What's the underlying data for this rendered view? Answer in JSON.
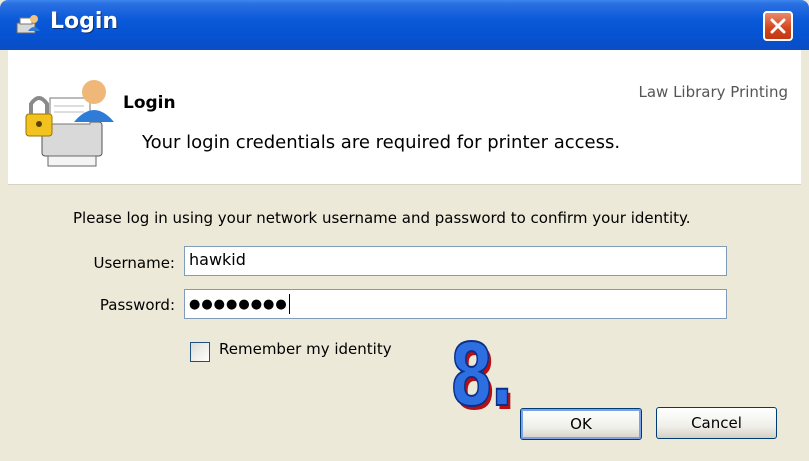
{
  "window": {
    "title": "Login"
  },
  "header": {
    "title": "Login",
    "subtitle": "Your login credentials are required for printer access.",
    "brand": "Law Library Printing"
  },
  "body": {
    "instructions": "Please log in using your network username and password to confirm your identity.",
    "username_label": "Username:",
    "username_value": "hawkid",
    "password_label": "Password:",
    "password_value": "●●●●●●●●",
    "remember_label": "Remember my identity",
    "remember_checked": false,
    "step_badge": "8."
  },
  "buttons": {
    "ok": "OK",
    "cancel": "Cancel"
  },
  "icons": {
    "title": "printer-user-icon",
    "header": "lock-printer-user-icon",
    "close": "close-icon"
  },
  "colors": {
    "titlebar": "#0553d2",
    "badge": "#2d6fe0",
    "badge_shadow": "#b80f12"
  }
}
